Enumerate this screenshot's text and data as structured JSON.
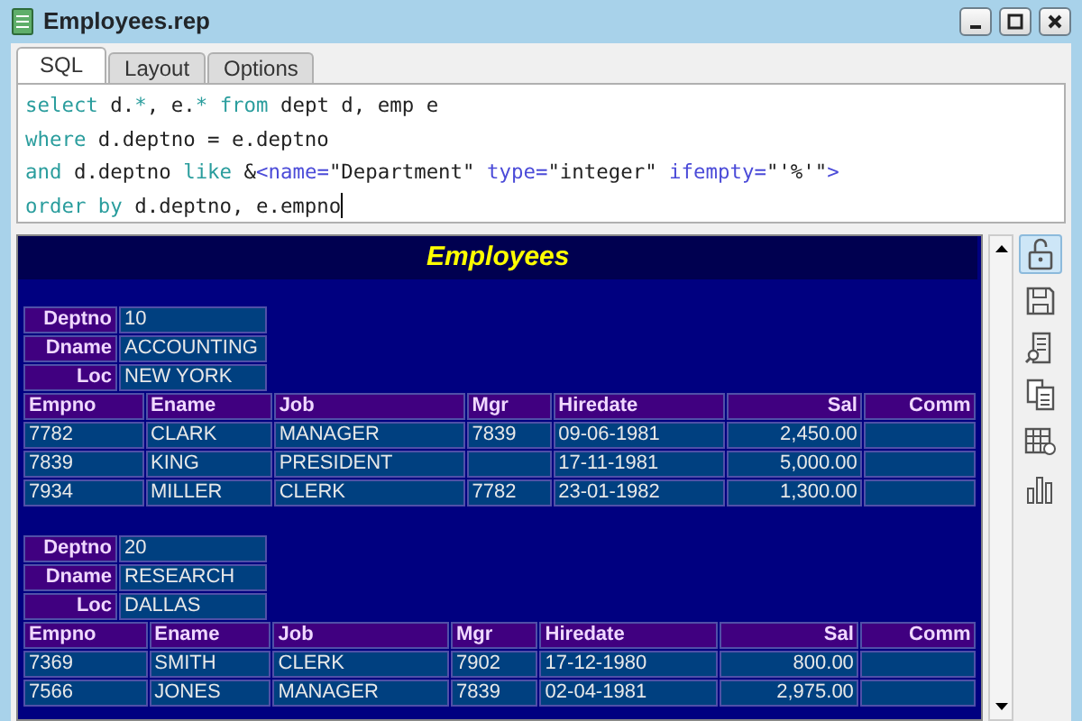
{
  "window": {
    "title": "Employees.rep"
  },
  "tabs": [
    {
      "label": "SQL",
      "selected": true
    },
    {
      "label": "Layout",
      "selected": false
    },
    {
      "label": "Options",
      "selected": false
    }
  ],
  "sql_lines": [
    [
      {
        "kind": "keyword",
        "text": "select"
      },
      {
        "kind": "plain",
        "text": " d."
      },
      {
        "kind": "keyword",
        "text": "*"
      },
      {
        "kind": "plain",
        "text": ", e."
      },
      {
        "kind": "keyword",
        "text": "* from"
      },
      {
        "kind": "plain",
        "text": " dept d, emp e"
      }
    ],
    [
      {
        "kind": "keyword",
        "text": "where"
      },
      {
        "kind": "plain",
        "text": " d.deptno = e.deptno"
      }
    ],
    [
      {
        "kind": "keyword",
        "text": "and"
      },
      {
        "kind": "plain",
        "text": " d.deptno "
      },
      {
        "kind": "keyword",
        "text": "like"
      },
      {
        "kind": "plain",
        "text": " &"
      },
      {
        "kind": "markup",
        "text": "<name="
      },
      {
        "kind": "plain",
        "text": "\"Department\" "
      },
      {
        "kind": "markup",
        "text": "type="
      },
      {
        "kind": "plain",
        "text": "\"integer\" "
      },
      {
        "kind": "markup",
        "text": "ifempty="
      },
      {
        "kind": "plain",
        "text": "\"'%'\""
      },
      {
        "kind": "markup",
        "text": ">"
      }
    ],
    [
      {
        "kind": "keyword",
        "text": "order by"
      },
      {
        "kind": "plain",
        "text": " d.deptno, e.empno"
      }
    ]
  ],
  "report": {
    "title": "Employees",
    "groups": [
      {
        "fields": [
          {
            "label": "Deptno",
            "value": "10"
          },
          {
            "label": "Dname",
            "value": "ACCOUNTING"
          },
          {
            "label": "Loc",
            "value": "NEW YORK"
          }
        ],
        "columns": [
          {
            "label": "Empno",
            "kind": "text"
          },
          {
            "label": "Ename",
            "kind": "text"
          },
          {
            "label": "Job",
            "kind": "text"
          },
          {
            "label": "Mgr",
            "kind": "text"
          },
          {
            "label": "Hiredate",
            "kind": "text"
          },
          {
            "label": "Sal",
            "kind": "number"
          },
          {
            "label": "Comm",
            "kind": "number"
          }
        ],
        "rows": [
          [
            "7782",
            "CLARK",
            "MANAGER",
            "7839",
            "09-06-1981",
            "2,450.00",
            ""
          ],
          [
            "7839",
            "KING",
            "PRESIDENT",
            "",
            "17-11-1981",
            "5,000.00",
            ""
          ],
          [
            "7934",
            "MILLER",
            "CLERK",
            "7782",
            "23-01-1982",
            "1,300.00",
            ""
          ]
        ]
      },
      {
        "fields": [
          {
            "label": "Deptno",
            "value": "20"
          },
          {
            "label": "Dname",
            "value": "RESEARCH"
          },
          {
            "label": "Loc",
            "value": "DALLAS"
          }
        ],
        "columns": [
          {
            "label": "Empno",
            "kind": "text"
          },
          {
            "label": "Ename",
            "kind": "text"
          },
          {
            "label": "Job",
            "kind": "text"
          },
          {
            "label": "Mgr",
            "kind": "text"
          },
          {
            "label": "Hiredate",
            "kind": "text"
          },
          {
            "label": "Sal",
            "kind": "number"
          },
          {
            "label": "Comm",
            "kind": "number"
          }
        ],
        "rows": [
          [
            "7369",
            "SMITH",
            "CLERK",
            "7902",
            "17-12-1980",
            "800.00",
            ""
          ],
          [
            "7566",
            "JONES",
            "MANAGER",
            "7839",
            "02-04-1981",
            "2,975.00",
            ""
          ]
        ]
      }
    ]
  },
  "tools": [
    {
      "kind": "unlock",
      "selected": true
    },
    {
      "kind": "save",
      "selected": false
    },
    {
      "kind": "preview",
      "selected": false
    },
    {
      "kind": "copy",
      "selected": false
    },
    {
      "kind": "table",
      "selected": false
    },
    {
      "kind": "chart",
      "selected": false
    }
  ]
}
